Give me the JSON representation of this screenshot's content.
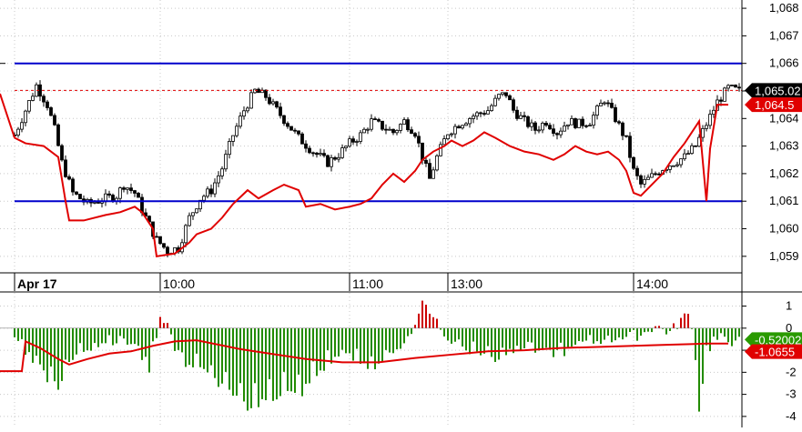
{
  "colors": {
    "candle": "#000000",
    "red_line": "#e00000",
    "level_line": "#0000cc",
    "grid": "#c8c8c8",
    "hist_up": "#cc0000",
    "hist_down": "#228b00",
    "badge_price": "#000000",
    "badge_red": "#e00000",
    "badge_green": "#2a9a00"
  },
  "chart_data": [
    {
      "type": "candlestick",
      "panel": "price",
      "ylim": [
        1058.4,
        1068.3
      ],
      "y_ticks": [
        "1,068",
        "1,067",
        "1,066",
        "1,065",
        "1,064",
        "1,063",
        "1,062",
        "1,061",
        "1,060",
        "1,059"
      ],
      "y_tick_values": [
        1068,
        1067,
        1066,
        1065,
        1064,
        1063,
        1062,
        1061,
        1060,
        1059
      ],
      "x_ticks": [
        "Apr 17",
        "10:00",
        "11:00",
        "13:00",
        "14:00"
      ],
      "x_tick_bar_index": [
        0,
        40,
        92,
        119,
        170
      ],
      "bar_count": 200,
      "close_anchors": [
        [
          0,
          1063.4
        ],
        [
          3,
          1064.3
        ],
        [
          6,
          1065.2
        ],
        [
          9,
          1064.5
        ],
        [
          11,
          1063.6
        ],
        [
          13,
          1062.4
        ],
        [
          16,
          1061.3
        ],
        [
          20,
          1060.9
        ],
        [
          25,
          1061.1
        ],
        [
          28,
          1061.2
        ],
        [
          30,
          1061.6
        ],
        [
          33,
          1061.3
        ],
        [
          36,
          1060.4
        ],
        [
          39,
          1059.6
        ],
        [
          42,
          1059.2
        ],
        [
          45,
          1059.3
        ],
        [
          48,
          1060.4
        ],
        [
          51,
          1061.1
        ],
        [
          54,
          1061.4
        ],
        [
          57,
          1062.2
        ],
        [
          60,
          1063.4
        ],
        [
          63,
          1064.3
        ],
        [
          66,
          1065.0
        ],
        [
          69,
          1064.8
        ],
        [
          72,
          1064.3
        ],
        [
          75,
          1063.8
        ],
        [
          78,
          1063.3
        ],
        [
          82,
          1062.8
        ],
        [
          86,
          1062.4
        ],
        [
          89,
          1062.7
        ],
        [
          92,
          1063.1
        ],
        [
          95,
          1063.4
        ],
        [
          98,
          1063.9
        ],
        [
          101,
          1063.7
        ],
        [
          104,
          1063.5
        ],
        [
          107,
          1063.9
        ],
        [
          110,
          1063.5
        ],
        [
          112,
          1062.6
        ],
        [
          114,
          1061.8
        ],
        [
          116,
          1062.6
        ],
        [
          119,
          1063.5
        ],
        [
          122,
          1063.8
        ],
        [
          126,
          1064.1
        ],
        [
          130,
          1064.3
        ],
        [
          133,
          1064.8
        ],
        [
          135,
          1064.9
        ],
        [
          137,
          1064.3
        ],
        [
          140,
          1063.9
        ],
        [
          143,
          1063.6
        ],
        [
          146,
          1063.9
        ],
        [
          149,
          1063.5
        ],
        [
          152,
          1063.9
        ],
        [
          155,
          1063.8
        ],
        [
          158,
          1063.9
        ],
        [
          160,
          1064.3
        ],
        [
          162,
          1064.7
        ],
        [
          165,
          1064.0
        ],
        [
          168,
          1063.2
        ],
        [
          170,
          1062.1
        ],
        [
          172,
          1061.6
        ],
        [
          175,
          1061.9
        ],
        [
          178,
          1062.2
        ],
        [
          181,
          1062.4
        ],
        [
          184,
          1062.6
        ],
        [
          187,
          1063.0
        ],
        [
          190,
          1063.8
        ],
        [
          193,
          1064.6
        ],
        [
          196,
          1065.1
        ],
        [
          199,
          1065.0
        ]
      ],
      "series": [
        {
          "name": "",
          "type": "line",
          "anchors": [
            [
              0,
              1063.3
            ],
            [
              3,
              1063.1
            ],
            [
              8,
              1063.0
            ],
            [
              12,
              1062.6
            ],
            [
              14,
              1061.0
            ],
            [
              15,
              1060.3
            ],
            [
              19,
              1060.3
            ],
            [
              25,
              1060.5
            ],
            [
              29,
              1060.6
            ],
            [
              33,
              1060.8
            ],
            [
              35,
              1060.6
            ],
            [
              38,
              1060.0
            ],
            [
              39,
              1059.0
            ],
            [
              44,
              1059.1
            ],
            [
              48,
              1059.5
            ],
            [
              50,
              1059.8
            ],
            [
              54,
              1060.0
            ],
            [
              57,
              1060.4
            ],
            [
              60,
              1060.9
            ],
            [
              64,
              1061.4
            ],
            [
              67,
              1061.1
            ],
            [
              71,
              1061.4
            ],
            [
              74,
              1061.6
            ],
            [
              78,
              1061.4
            ],
            [
              80,
              1060.8
            ],
            [
              84,
              1060.9
            ],
            [
              88,
              1060.7
            ],
            [
              92,
              1060.8
            ],
            [
              95,
              1060.9
            ],
            [
              98,
              1061.1
            ],
            [
              101,
              1061.6
            ],
            [
              104,
              1062.0
            ],
            [
              107,
              1061.7
            ],
            [
              110,
              1062.1
            ],
            [
              112,
              1062.5
            ],
            [
              115,
              1062.8
            ],
            [
              118,
              1063.0
            ],
            [
              120,
              1063.2
            ],
            [
              123,
              1063.0
            ],
            [
              126,
              1063.2
            ],
            [
              129,
              1063.5
            ],
            [
              132,
              1063.3
            ],
            [
              136,
              1063.0
            ],
            [
              140,
              1062.8
            ],
            [
              144,
              1062.7
            ],
            [
              148,
              1062.5
            ],
            [
              151,
              1062.7
            ],
            [
              154,
              1063.0
            ],
            [
              157,
              1062.8
            ],
            [
              160,
              1062.7
            ],
            [
              163,
              1062.8
            ],
            [
              166,
              1062.5
            ],
            [
              168,
              1062.1
            ],
            [
              170,
              1061.3
            ],
            [
              172,
              1061.2
            ],
            [
              175,
              1061.6
            ],
            [
              178,
              1062.0
            ],
            [
              181,
              1062.6
            ],
            [
              184,
              1063.1
            ],
            [
              186,
              1063.5
            ],
            [
              188,
              1063.9
            ],
            [
              190,
              1061.0
            ],
            [
              191,
              1062.9
            ],
            [
              193,
              1064.5
            ],
            [
              196,
              1064.5
            ]
          ]
        },
        {
          "name": "",
          "type": "hline",
          "value": 1066.0
        },
        {
          "name": "",
          "type": "hline",
          "value": 1061.0
        },
        {
          "name": "",
          "type": "dashed-hline",
          "value": 1065.02
        }
      ],
      "badges": [
        "1,065.02",
        "1,064.5"
      ],
      "grid": true
    },
    {
      "type": "bar",
      "panel": "histogram",
      "ylim": [
        -4.5,
        1.6
      ],
      "y_ticks": [
        "1",
        "0",
        "-1",
        "-2",
        "-3",
        "-4"
      ],
      "y_tick_values": [
        1,
        0,
        -1,
        -2,
        -3,
        -4
      ],
      "zero_line": true,
      "hist_anchors": [
        [
          0,
          -0.4
        ],
        [
          3,
          -1.0
        ],
        [
          6,
          -1.6
        ],
        [
          9,
          -2.2
        ],
        [
          12,
          -2.6
        ],
        [
          14,
          -2.0
        ],
        [
          17,
          -1.2
        ],
        [
          20,
          -0.9
        ],
        [
          23,
          -0.7
        ],
        [
          26,
          -0.5
        ],
        [
          30,
          -0.6
        ],
        [
          34,
          -1.0
        ],
        [
          37,
          -1.8
        ],
        [
          40,
          0.55
        ],
        [
          42,
          0.3
        ],
        [
          44,
          -1.0
        ],
        [
          47,
          -1.6
        ],
        [
          50,
          -1.8
        ],
        [
          54,
          -2.2
        ],
        [
          58,
          -2.9
        ],
        [
          62,
          -3.4
        ],
        [
          66,
          -3.6
        ],
        [
          70,
          -3.2
        ],
        [
          74,
          -2.9
        ],
        [
          78,
          -3.1
        ],
        [
          82,
          -2.3
        ],
        [
          86,
          -1.6
        ],
        [
          90,
          -1.2
        ],
        [
          94,
          -1.5
        ],
        [
          98,
          -1.8
        ],
        [
          102,
          -1.4
        ],
        [
          106,
          -1.1
        ],
        [
          108,
          -0.6
        ],
        [
          111,
          0.9
        ],
        [
          113,
          1.3
        ],
        [
          115,
          0.6
        ],
        [
          117,
          -0.2
        ],
        [
          120,
          -0.6
        ],
        [
          124,
          -0.9
        ],
        [
          128,
          -1.1
        ],
        [
          132,
          -1.4
        ],
        [
          136,
          -1.0
        ],
        [
          140,
          -0.8
        ],
        [
          144,
          -1.0
        ],
        [
          148,
          -1.3
        ],
        [
          152,
          -1.0
        ],
        [
          156,
          -0.7
        ],
        [
          160,
          -0.6
        ],
        [
          164,
          -0.5
        ],
        [
          168,
          -0.4
        ],
        [
          172,
          -0.3
        ],
        [
          176,
          0.1
        ],
        [
          180,
          -0.2
        ],
        [
          183,
          0.4
        ],
        [
          185,
          0.6
        ],
        [
          186,
          0.2
        ],
        [
          187,
          -1.5
        ],
        [
          188,
          -3.6
        ],
        [
          190,
          -1.2
        ],
        [
          192,
          -0.5
        ],
        [
          196,
          -0.6
        ]
      ],
      "signal_anchors": [
        [
          0,
          -1.95
        ],
        [
          2,
          -1.95
        ],
        [
          3,
          -0.6
        ],
        [
          7,
          -0.9
        ],
        [
          12,
          -1.4
        ],
        [
          15,
          -1.65
        ],
        [
          20,
          -1.4
        ],
        [
          26,
          -1.15
        ],
        [
          32,
          -1.05
        ],
        [
          38,
          -0.8
        ],
        [
          44,
          -0.6
        ],
        [
          50,
          -0.55
        ],
        [
          56,
          -0.75
        ],
        [
          62,
          -0.95
        ],
        [
          70,
          -1.15
        ],
        [
          80,
          -1.4
        ],
        [
          90,
          -1.55
        ],
        [
          100,
          -1.55
        ],
        [
          110,
          -1.35
        ],
        [
          120,
          -1.2
        ],
        [
          130,
          -1.05
        ],
        [
          140,
          -1.0
        ],
        [
          150,
          -0.9
        ],
        [
          160,
          -0.85
        ],
        [
          170,
          -0.8
        ],
        [
          180,
          -0.75
        ],
        [
          190,
          -0.7
        ],
        [
          196,
          -0.7
        ]
      ],
      "badges": [
        "-0.52002",
        "-1.0655"
      ],
      "grid": true
    }
  ]
}
